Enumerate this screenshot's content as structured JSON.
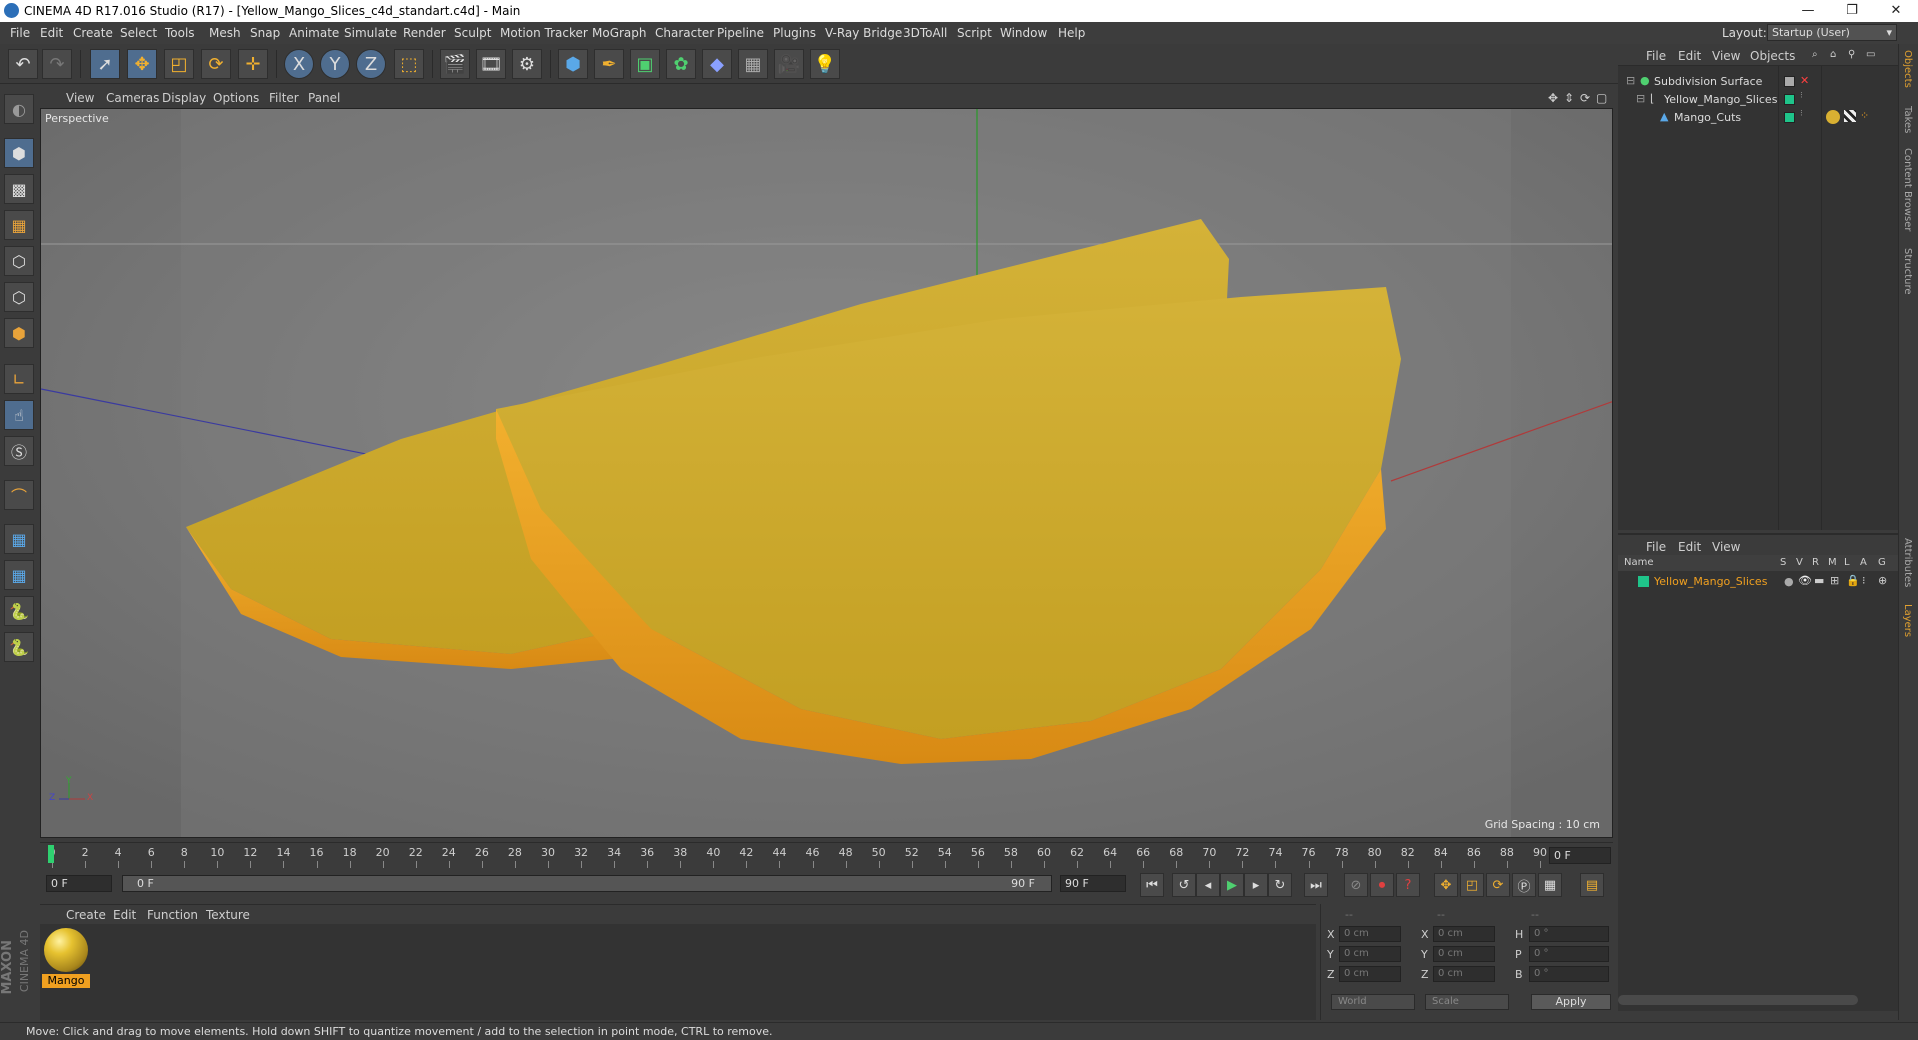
{
  "window": {
    "title": "CINEMA 4D R17.016 Studio (R17) - [Yellow_Mango_Slices_c4d_standart.c4d] - Main",
    "minimize": "—",
    "restore": "❐",
    "close": "✕"
  },
  "menu": [
    "File",
    "Edit",
    "Create",
    "Select",
    "Tools",
    "Mesh",
    "Snap",
    "Animate",
    "Simulate",
    "Render",
    "Sculpt",
    "Motion Tracker",
    "MoGraph",
    "Character",
    "Pipeline",
    "Plugins",
    "V-Ray Bridge",
    "3DToAll",
    "Script",
    "Window",
    "Help"
  ],
  "layout": {
    "label": "Layout:",
    "value": "Startup (User)"
  },
  "toolbar": {
    "icons": [
      "undo-icon",
      "redo-icon",
      "select-arrow-icon",
      "move-icon",
      "scale-icon",
      "rotate-icon",
      "live-move-icon",
      "x-axis-icon",
      "y-axis-icon",
      "z-axis-icon",
      "coordinate-system-icon",
      "render-view-icon",
      "render-picture-viewer-icon",
      "render-settings-icon",
      "cube-icon",
      "pen-icon",
      "subdivision-icon",
      "cloner-icon",
      "deformer-icon",
      "floor-icon",
      "camera-icon",
      "light-icon"
    ],
    "axis_labels": [
      "X",
      "Y",
      "Z"
    ]
  },
  "viewport": {
    "menu": [
      "View",
      "Cameras",
      "Display",
      "Options",
      "Filter",
      "Panel"
    ],
    "label": "Perspective",
    "grid_spacing": "Grid Spacing : 10 cm",
    "axis_x": "X",
    "axis_y": "Y",
    "axis_z": "Z"
  },
  "timeline": {
    "ticks": [
      "0",
      "2",
      "4",
      "6",
      "8",
      "10",
      "12",
      "14",
      "16",
      "18",
      "20",
      "22",
      "24",
      "26",
      "28",
      "30",
      "32",
      "34",
      "36",
      "38",
      "40",
      "42",
      "44",
      "46",
      "48",
      "50",
      "52",
      "54",
      "56",
      "58",
      "60",
      "62",
      "64",
      "66",
      "68",
      "70",
      "72",
      "74",
      "76",
      "78",
      "80",
      "82",
      "84",
      "86",
      "88",
      "90"
    ],
    "current_frame_end": "0 F",
    "start_field": "0 F",
    "range_start": "0 F",
    "range_end": "90 F",
    "end_field": "90 F"
  },
  "materials": {
    "menu": [
      "Create",
      "Edit",
      "Function",
      "Texture"
    ],
    "items": [
      {
        "name": "Mango"
      }
    ]
  },
  "coordinates": {
    "headers": [
      "--",
      "--",
      "--"
    ],
    "rows": [
      {
        "a": "X",
        "av": "0 cm",
        "b": "X",
        "bv": "0 cm",
        "c": "H",
        "cv": "0 °"
      },
      {
        "a": "Y",
        "av": "0 cm",
        "b": "Y",
        "bv": "0 cm",
        "c": "P",
        "cv": "0 °"
      },
      {
        "a": "Z",
        "av": "0 cm",
        "b": "Z",
        "bv": "0 cm",
        "c": "B",
        "cv": "0 °"
      }
    ],
    "mode": "World",
    "type": "Scale",
    "apply": "Apply"
  },
  "objects": {
    "menu": [
      "File",
      "Edit",
      "View",
      "Objects"
    ],
    "items": [
      {
        "name": "Subdivision Surface"
      },
      {
        "name": "Yellow_Mango_Slices"
      },
      {
        "name": "Mango_Cuts"
      }
    ]
  },
  "layers": {
    "menu": [
      "File",
      "Edit",
      "View"
    ],
    "header": {
      "name": "Name",
      "cols": [
        "S",
        "V",
        "R",
        "M",
        "L",
        "A",
        "G"
      ]
    },
    "items": [
      {
        "name": "Yellow_Mango_Slices"
      }
    ]
  },
  "right_tabs": [
    "Objects",
    "Takes",
    "Content Browser",
    "Structure",
    "Attributes",
    "Layers"
  ],
  "status": "Move: Click and drag to move elements. Hold down SHIFT to quantize movement / add to the selection in point mode, CTRL to remove.",
  "brand": {
    "maxon": "MAXON",
    "c4d": "CINEMA 4D"
  },
  "colors": {
    "accent": "#4f6d8f",
    "mango": "#d9b032",
    "layer_green": "#1fc48a",
    "highlight": "#f0a020"
  }
}
